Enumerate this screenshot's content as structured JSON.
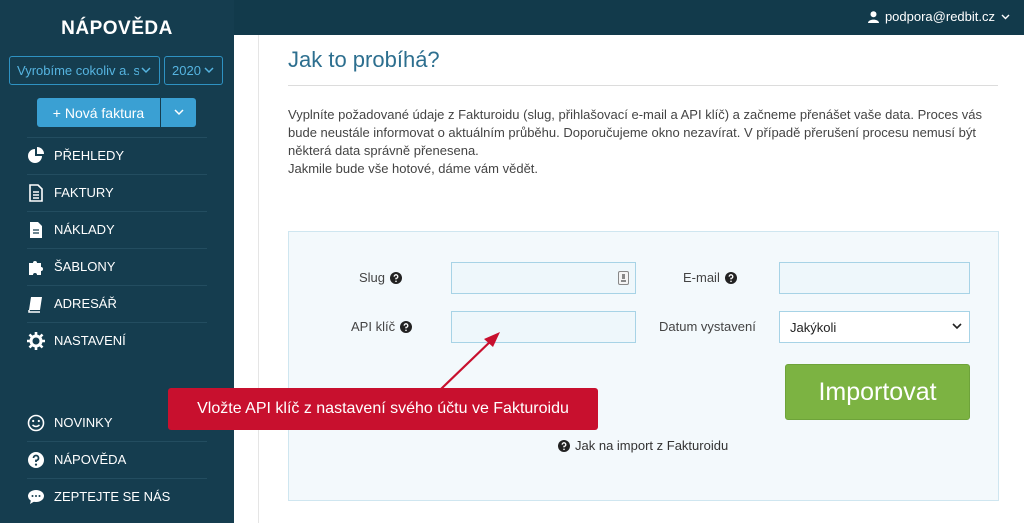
{
  "user": {
    "email": "podpora@redbit.cz"
  },
  "sidebar": {
    "brand": "NÁPOVĚDA",
    "company_select": "Vyrobíme cokoliv a. s.",
    "year_select": "2020",
    "new_invoice_label": "+ Nová faktura",
    "items": [
      {
        "label": "PŘEHLEDY",
        "icon": "pie-chart-icon"
      },
      {
        "label": "FAKTURY",
        "icon": "document-icon"
      },
      {
        "label": "NÁKLADY",
        "icon": "file-icon"
      },
      {
        "label": "ŠABLONY",
        "icon": "puzzle-icon"
      },
      {
        "label": "ADRESÁŘ",
        "icon": "book-icon"
      },
      {
        "label": "NASTAVENÍ",
        "icon": "gear-icon"
      },
      {
        "label": "NOVINKY",
        "icon": "smile-icon"
      },
      {
        "label": "NÁPOVĚDA",
        "icon": "question-icon"
      },
      {
        "label": "ZEPTEJTE SE NÁS",
        "icon": "chat-icon"
      }
    ]
  },
  "main": {
    "title": "Jak to probíhá?",
    "description": [
      "Vyplníte požadované údaje z Fakturoidu (slug, přihlašovací e-mail a API klíč) a začneme přenášet vaše data. Proces vás",
      "bude neustále informovat o aktuálním průběhu. Doporučujeme okno nezavírat. V případě přerušení procesu nemusí být",
      "některá data správně přenesena.",
      "Jakmile bude vše hotové, dáme vám vědět."
    ],
    "form": {
      "slug_label": "Slug",
      "email_label": "E-mail",
      "api_key_label": "API klíč",
      "date_label": "Datum vystavení",
      "date_value": "Jakýkoli",
      "import_button": "Importovat",
      "help_link": "Jak na import z Fakturoidu"
    }
  },
  "callout": {
    "text": "Vložte API klíč z nastavení svého účtu ve Fakturoidu"
  },
  "colors": {
    "sidebar": "#153d4f",
    "accent": "#3aa0d3",
    "import": "#7cb342",
    "callout": "#c8102e",
    "title": "#2d6f8f"
  }
}
